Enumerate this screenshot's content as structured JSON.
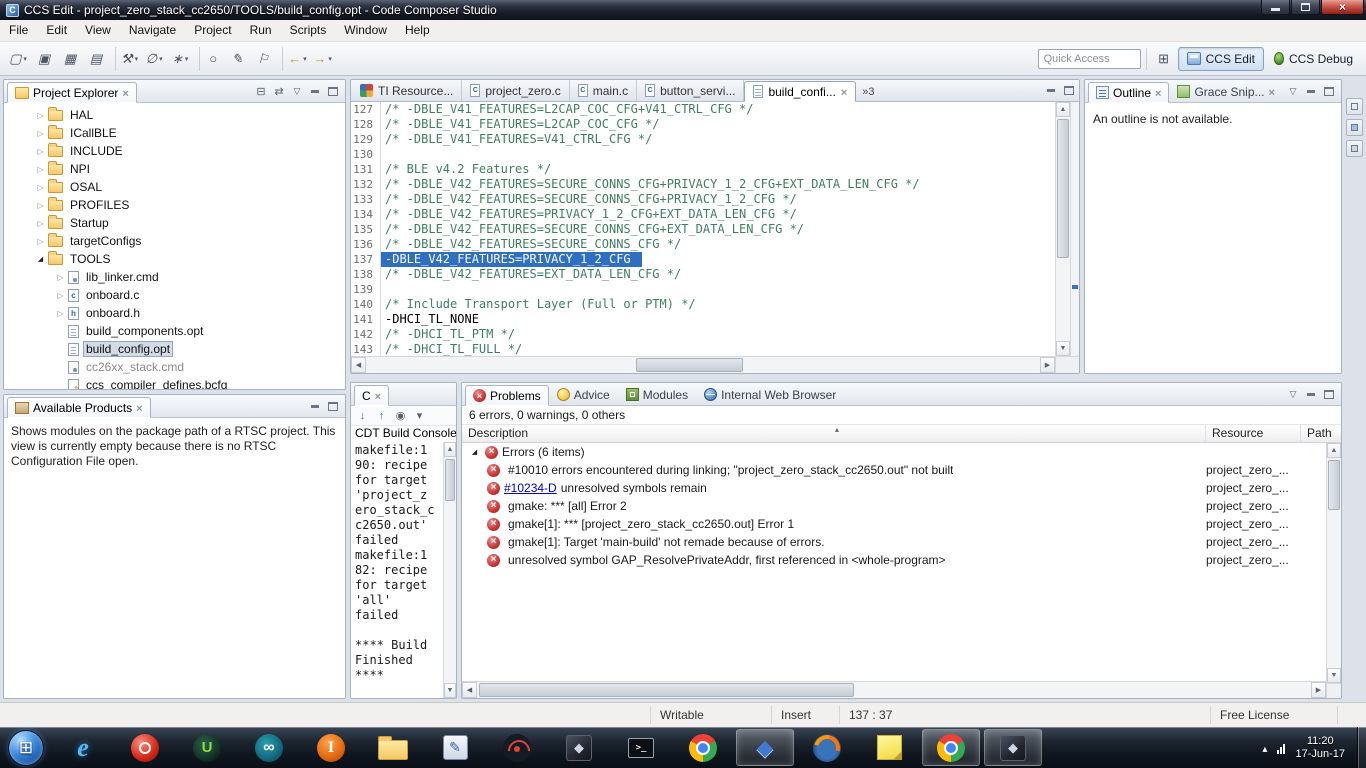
{
  "colors": {
    "selection_blue": "#2f6fc1",
    "error_red": "#c93434",
    "link_blue": "#0000cc",
    "comment_green": "#3f7f5f"
  },
  "window": {
    "title": "CCS Edit - project_zero_stack_cc2650/TOOLS/build_config.opt - Code Composer Studio"
  },
  "menubar": {
    "items": [
      "File",
      "Edit",
      "View",
      "Navigate",
      "Project",
      "Run",
      "Scripts",
      "Window",
      "Help"
    ]
  },
  "toolbar": {
    "buttons": [
      {
        "name": "new-button",
        "glyph": "▢",
        "cls": "drop"
      },
      {
        "name": "save-button",
        "glyph": "▣",
        "cls": ""
      },
      {
        "name": "save-all-button",
        "glyph": "▦",
        "cls": ""
      },
      {
        "name": "print-button",
        "glyph": "▤",
        "cls": ""
      },
      {
        "name": "build-button",
        "glyph": "⚒",
        "cls": "drop new-group"
      },
      {
        "name": "debug-button",
        "glyph": "∅",
        "cls": "drop"
      },
      {
        "name": "new-wizard-button",
        "glyph": "∗",
        "cls": "drop"
      },
      {
        "name": "search-button",
        "glyph": "○",
        "cls": "new-group"
      },
      {
        "name": "pencil-button",
        "glyph": "✎",
        "cls": ""
      },
      {
        "name": "flag-button",
        "glyph": "⚐",
        "cls": ""
      },
      {
        "name": "back-button",
        "glyph": "←",
        "cls": "drop nav new-group"
      },
      {
        "name": "forward-button",
        "glyph": "→",
        "cls": "drop nav"
      }
    ],
    "quick_access_placeholder": "Quick Access",
    "perspective_edit": "CCS Edit",
    "perspective_debug": "CCS Debug"
  },
  "project_explorer": {
    "title": "Project Explorer",
    "items": [
      {
        "label": "HAL",
        "cls": "lvl2 folder",
        "arrow": "collapsed"
      },
      {
        "label": "ICallBLE",
        "cls": "lvl2 folder",
        "arrow": "collapsed"
      },
      {
        "label": "INCLUDE",
        "cls": "lvl2 folder",
        "arrow": "collapsed"
      },
      {
        "label": "NPI",
        "cls": "lvl2 folder",
        "arrow": "collapsed"
      },
      {
        "label": "OSAL",
        "cls": "lvl2 folder",
        "arrow": "collapsed"
      },
      {
        "label": "PROFILES",
        "cls": "lvl2 folder",
        "arrow": "collapsed"
      },
      {
        "label": "Startup",
        "cls": "lvl2 folder",
        "arrow": "collapsed"
      },
      {
        "label": "targetConfigs",
        "cls": "lvl2 folder",
        "arrow": "collapsed"
      },
      {
        "label": "TOOLS",
        "cls": "lvl2 folder",
        "arrow": "expanded"
      },
      {
        "label": "lib_linker.cmd",
        "cls": "lvl3 filecmd",
        "arrow": "collapsed"
      },
      {
        "label": "onboard.c",
        "cls": "lvl3 filec",
        "arrow": "collapsed"
      },
      {
        "label": "onboard.h",
        "cls": "lvl3 fileh",
        "arrow": "collapsed"
      },
      {
        "label": "build_components.opt",
        "cls": "lvl3 fileopt",
        "arrow": "none"
      },
      {
        "label": "build_config.opt",
        "cls": "lvl3 fileopt selected",
        "arrow": "none"
      },
      {
        "label": "cc26xx_stack.cmd",
        "cls": "lvl3 filecmd dim",
        "arrow": "none"
      },
      {
        "label": "ccs_compiler_defines.bcfg",
        "cls": "lvl3 filebcfg",
        "arrow": "none"
      }
    ]
  },
  "available_products": {
    "title": "Available Products",
    "body": "Shows modules on the package path of a RTSC project. This view is currently empty because there is no RTSC Configuration File open."
  },
  "editor": {
    "tabs": [
      {
        "label": "TI Resource...",
        "cls": "",
        "icon": "resource"
      },
      {
        "label": "project_zero.c",
        "cls": "",
        "icon": "cfile"
      },
      {
        "label": "main.c",
        "cls": "",
        "icon": "cfile"
      },
      {
        "label": "button_servi...",
        "cls": "",
        "icon": "cfile"
      },
      {
        "label": "build_confi...",
        "cls": "active",
        "icon": "optfile"
      }
    ],
    "overflow_indicator": "»3",
    "lines": [
      {
        "num": "127",
        "text": "/* -DBLE_V41_FEATURES=L2CAP_COC_CFG+V41_CTRL_CFG */",
        "cls": "comment"
      },
      {
        "num": "128",
        "text": "/* -DBLE_V41_FEATURES=L2CAP_COC_CFG */",
        "cls": "comment"
      },
      {
        "num": "129",
        "text": "/* -DBLE_V41_FEATURES=V41_CTRL_CFG */",
        "cls": "comment"
      },
      {
        "num": "130",
        "text": "",
        "cls": ""
      },
      {
        "num": "131",
        "text": "/* BLE v4.2 Features */",
        "cls": "comment"
      },
      {
        "num": "132",
        "text": "/* -DBLE_V42_FEATURES=SECURE_CONNS_CFG+PRIVACY_1_2_CFG+EXT_DATA_LEN_CFG */",
        "cls": "comment"
      },
      {
        "num": "133",
        "text": "/* -DBLE_V42_FEATURES=SECURE_CONNS_CFG+PRIVACY_1_2_CFG */",
        "cls": "comment"
      },
      {
        "num": "134",
        "text": "/* -DBLE_V42_FEATURES=PRIVACY_1_2_CFG+EXT_DATA_LEN_CFG */",
        "cls": "comment"
      },
      {
        "num": "135",
        "text": "/* -DBLE_V42_FEATURES=SECURE_CONNS_CFG+EXT_DATA_LEN_CFG */",
        "cls": "comment"
      },
      {
        "num": "136",
        "text": "/* -DBLE_V42_FEATURES=SECURE_CONNS_CFG */",
        "cls": "comment"
      },
      {
        "num": "137",
        "text": "-DBLE_V42_FEATURES=PRIVACY_1_2_CFG ",
        "cls": "plain hl"
      },
      {
        "num": "138",
        "text": "/* -DBLE_V42_FEATURES=EXT_DATA_LEN_CFG */",
        "cls": "comment"
      },
      {
        "num": "139",
        "text": "",
        "cls": ""
      },
      {
        "num": "140",
        "text": "/* Include Transport Layer (Full or PTM) */",
        "cls": "comment"
      },
      {
        "num": "141",
        "text": "-DHCI_TL_NONE",
        "cls": "plain"
      },
      {
        "num": "142",
        "text": "/* -DHCI_TL_PTM */",
        "cls": "comment"
      },
      {
        "num": "143",
        "text": "/* -DHCI_TL_FULL */",
        "cls": "comment"
      }
    ]
  },
  "console": {
    "tab": "C",
    "label": "CDT Build Console",
    "icons": [
      {
        "name": "console-scroll-down-icon",
        "glyph": "↓",
        "cls": "blue"
      },
      {
        "name": "console-scroll-up-icon",
        "glyph": "↑",
        "cls": "blue"
      },
      {
        "name": "console-pin-icon",
        "glyph": "◉",
        "cls": ""
      },
      {
        "name": "console-menu-icon",
        "glyph": "▾",
        "cls": ""
      }
    ],
    "lines": [
      "makefile:1",
      "90: recipe",
      "for target",
      "'project_z",
      "ero_stack_c",
      "c2650.out'",
      "failed",
      "makefile:1",
      "82: recipe",
      "for target",
      "'all'",
      "failed",
      "",
      "**** Build",
      "Finished",
      "****"
    ]
  },
  "problems": {
    "tabs": [
      {
        "label": "Problems",
        "cls": "active",
        "icon": "problems"
      },
      {
        "label": "Advice",
        "cls": "",
        "icon": "advice"
      },
      {
        "label": "Modules",
        "cls": "",
        "icon": "modules"
      },
      {
        "label": "Internal Web Browser",
        "cls": "",
        "icon": "browser"
      }
    ],
    "summary": "6 errors, 0 warnings, 0 others",
    "columns": [
      "Description",
      "Resource",
      "Path"
    ],
    "group": "Errors (6 items)",
    "rows": [
      {
        "link": "",
        "text": "#10010 errors encountered during linking; \"project_zero_stack_cc2650.out\" not built",
        "resource": "project_zero_...",
        "path": ""
      },
      {
        "link": "#10234-D",
        "text": " unresolved symbols remain",
        "resource": "project_zero_...",
        "path": ""
      },
      {
        "link": "",
        "text": "gmake: *** [all] Error 2",
        "resource": "project_zero_...",
        "path": ""
      },
      {
        "link": "",
        "text": "gmake[1]: *** [project_zero_stack_cc2650.out] Error 1",
        "resource": "project_zero_...",
        "path": ""
      },
      {
        "link": "",
        "text": "gmake[1]: Target 'main-build' not remade because of errors.",
        "resource": "project_zero_...",
        "path": ""
      },
      {
        "link": "",
        "text": "unresolved symbol GAP_ResolvePrivateAddr, first referenced in <whole-program>",
        "resource": "project_zero_...",
        "path": ""
      }
    ]
  },
  "outline": {
    "tabs": [
      {
        "label": "Outline",
        "cls": "active",
        "icon": "outline"
      },
      {
        "label": "Grace Snip...",
        "cls": "",
        "icon": "grace"
      }
    ],
    "body": "An outline is not available."
  },
  "statusbar": {
    "writable": "Writable",
    "insert_mode": "Insert",
    "cursor_position": "137 : 37",
    "license": "Free License"
  },
  "taskbar": {
    "icons": [
      {
        "name": "internet-explorer-icon",
        "cls": "ic-ie",
        "glyph": "e"
      },
      {
        "name": "media-app-icon",
        "cls": "ic-red",
        "glyph": ""
      },
      {
        "name": "utorrent-icon",
        "cls": "ic-ut",
        "glyph": "U"
      },
      {
        "name": "infinity-app-icon",
        "cls": "ic-inf",
        "glyph": "∞"
      },
      {
        "name": "installer-app-icon",
        "cls": "ic-i",
        "glyph": "I"
      },
      {
        "name": "windows-explorer-icon",
        "cls": "ic-folder",
        "glyph": ""
      },
      {
        "name": "editor-app-icon",
        "cls": "ic-edit",
        "glyph": "✎"
      },
      {
        "name": "hotspot-app-icon",
        "cls": "ic-wifi",
        "glyph": ""
      },
      {
        "name": "cube-app-icon",
        "cls": "ic-cube",
        "glyph": "◆"
      },
      {
        "name": "terminal-icon",
        "cls": "ic-cmd",
        "glyph": ">_"
      },
      {
        "name": "chrome-icon",
        "cls": "ic-chrome",
        "glyph": ""
      },
      {
        "name": "virtualbox-icon",
        "cls": "ic-vbox open",
        "glyph": "◆"
      },
      {
        "name": "firefox-icon",
        "cls": "ic-ff",
        "glyph": ""
      },
      {
        "name": "sticky-notes-icon",
        "cls": "ic-notes",
        "glyph": ""
      },
      {
        "name": "chrome-icon-2",
        "cls": "ic-chrome open",
        "glyph": ""
      },
      {
        "name": "cube-app-icon-2",
        "cls": "ic-cube open",
        "glyph": "◆"
      }
    ],
    "clock_time": "11:20",
    "clock_date": "17-Jun-17"
  }
}
